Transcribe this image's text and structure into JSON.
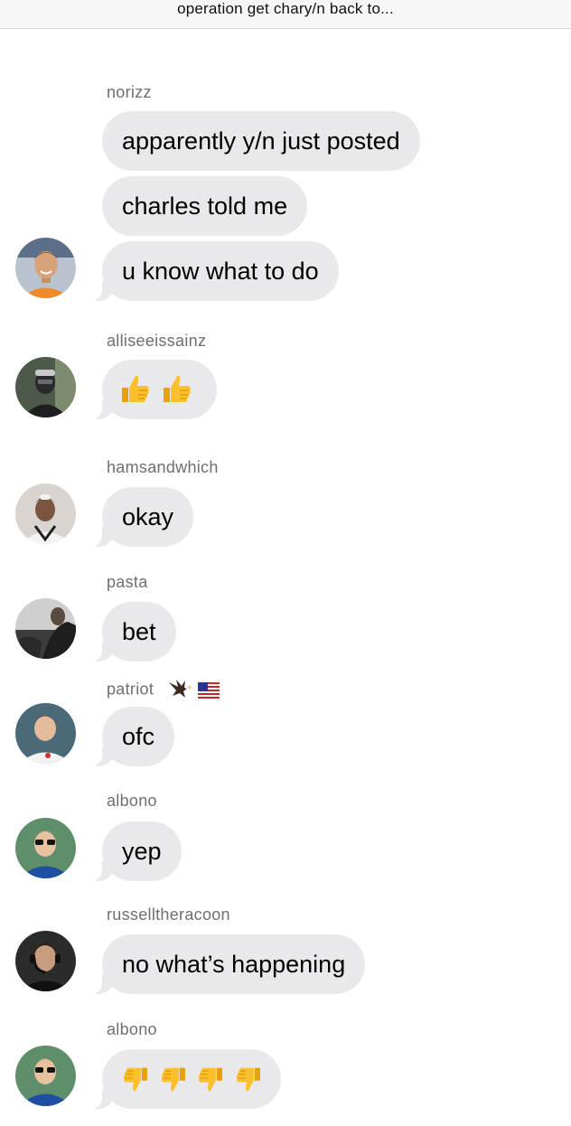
{
  "header": {
    "title": "operation get chary/n back to..."
  },
  "colors": {
    "bubble": "#e9e9eb",
    "sender": "#6e6e73",
    "header_bg": "#f7f7f7"
  },
  "groups": [
    {
      "sender": "norizz",
      "messages": [
        "apparently y/n just posted",
        "charles told me",
        "u know what to do"
      ],
      "avatar_icon": "person-orange-shirt-icon"
    },
    {
      "sender": "alliseeissainz",
      "messages": [
        "👍👍"
      ],
      "avatar_icon": "person-hooded-icon"
    },
    {
      "sender": "hamsandwhich",
      "messages": [
        "okay"
      ],
      "avatar_icon": "person-white-jacket-icon"
    },
    {
      "sender": "pasta",
      "messages": [
        "bet"
      ],
      "avatar_icon": "person-dark-photo-icon"
    },
    {
      "sender": "patriot",
      "sender_flair": [
        "eagle-icon",
        "us-flag-icon"
      ],
      "messages": [
        "ofc"
      ],
      "avatar_icon": "person-race-suit-icon"
    },
    {
      "sender": "albono",
      "messages": [
        "yep"
      ],
      "avatar_icon": "person-sunglasses-blue-icon"
    },
    {
      "sender": "russelltheracoon",
      "messages": [
        "no what’s happening"
      ],
      "avatar_icon": "person-headset-icon"
    },
    {
      "sender": "albono",
      "messages": [
        "👎👎👎👎"
      ],
      "avatar_icon": "person-sunglasses-blue-icon"
    }
  ]
}
